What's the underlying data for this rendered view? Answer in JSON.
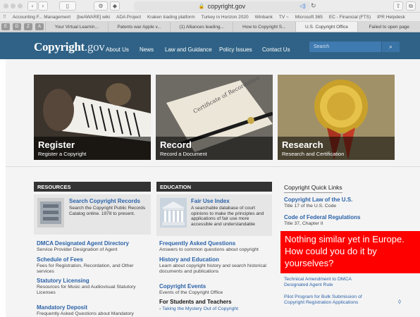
{
  "browser": {
    "url": "copyright.gov",
    "lock_icon": "lock-icon",
    "bookmarks": [
      "Accounting F... Management",
      "[beAWARE] wiki",
      "ADA Project",
      "Kraken trading platform",
      "Turkey in Horizon 2020",
      "Winbank",
      "TV ~",
      "Microsoft 365",
      "EC - Financial (FTS)",
      "IPR Helpdesk"
    ],
    "pinned": [
      "E",
      "D",
      "Z",
      "A"
    ],
    "tabs": [
      "Your Virtual Learnin...",
      "Patents war Apple v...",
      "(1) Alliances leading...",
      "How to Copyright S...",
      "U.S. Copyright Office",
      "Failed to open page"
    ],
    "active_tab": 4
  },
  "site": {
    "logo_main": "Copyright",
    "logo_gov": ".gov",
    "nav": [
      "About Us",
      "News",
      "Law and Guidance",
      "Policy Issues",
      "Contact Us"
    ],
    "search_placeholder": "Search"
  },
  "heroes": [
    {
      "title": "Register",
      "subtitle": "Register a Copyright"
    },
    {
      "title": "Record",
      "subtitle": "Record a Document",
      "doc_text": "Certificate of Recordation"
    },
    {
      "title": "Research",
      "subtitle": "Research and Certification"
    }
  ],
  "resources": {
    "header": "RESOURCES",
    "feature_title": "Search Copyright Records",
    "feature_text": "Search the Copyright Public Records Catalog online. 1978 to present.",
    "items": [
      {
        "title": "DMCA Designated Agent Directory",
        "desc": "Service Provider Designation of Agent"
      },
      {
        "title": "Schedule of Fees",
        "desc": "Fees for Registration, Recordation, and Other services"
      },
      {
        "title": "Statutory Licensing",
        "desc": "Resources for Music and Audiovisual Statutory Licenses"
      },
      {
        "title": "Mandatory Deposit",
        "desc": "Frequently Asked Questions about Mandatory"
      }
    ]
  },
  "education": {
    "header": "EDUCATION",
    "feature_title": "Fair Use Index",
    "feature_text": "A searchable database of court opinions to make the principles and applications of fair use more accessible and understandable",
    "items": [
      {
        "title": "Frequently Asked Questions",
        "desc": "Answers to common questions about copyright"
      },
      {
        "title": "History and Education",
        "desc": "Learn about copyright history and search historical documents and publications"
      },
      {
        "title": "Copyright Events",
        "desc": "Events of the Copyright Office"
      }
    ],
    "students_title": "For Students and Teachers",
    "students_link": "Taking the Mystery Out of Copyright"
  },
  "quick_links": {
    "title": "Copyright Quick Links",
    "items": [
      {
        "title": "Copyright Law of the U.S.",
        "desc": "Title 17 of the U.S. Code"
      },
      {
        "title": "Code of Federal Regulations",
        "desc": "Title 37, Chapter II"
      }
    ],
    "more": [
      "Technical Amendment to DMCA Designated Agent Rule",
      "Pilot Program for Bulk Submission of Copyright Registration Applications"
    ]
  },
  "overlay_text": "Nothing similar yet in Europe. How could you do it by yourselves?"
}
